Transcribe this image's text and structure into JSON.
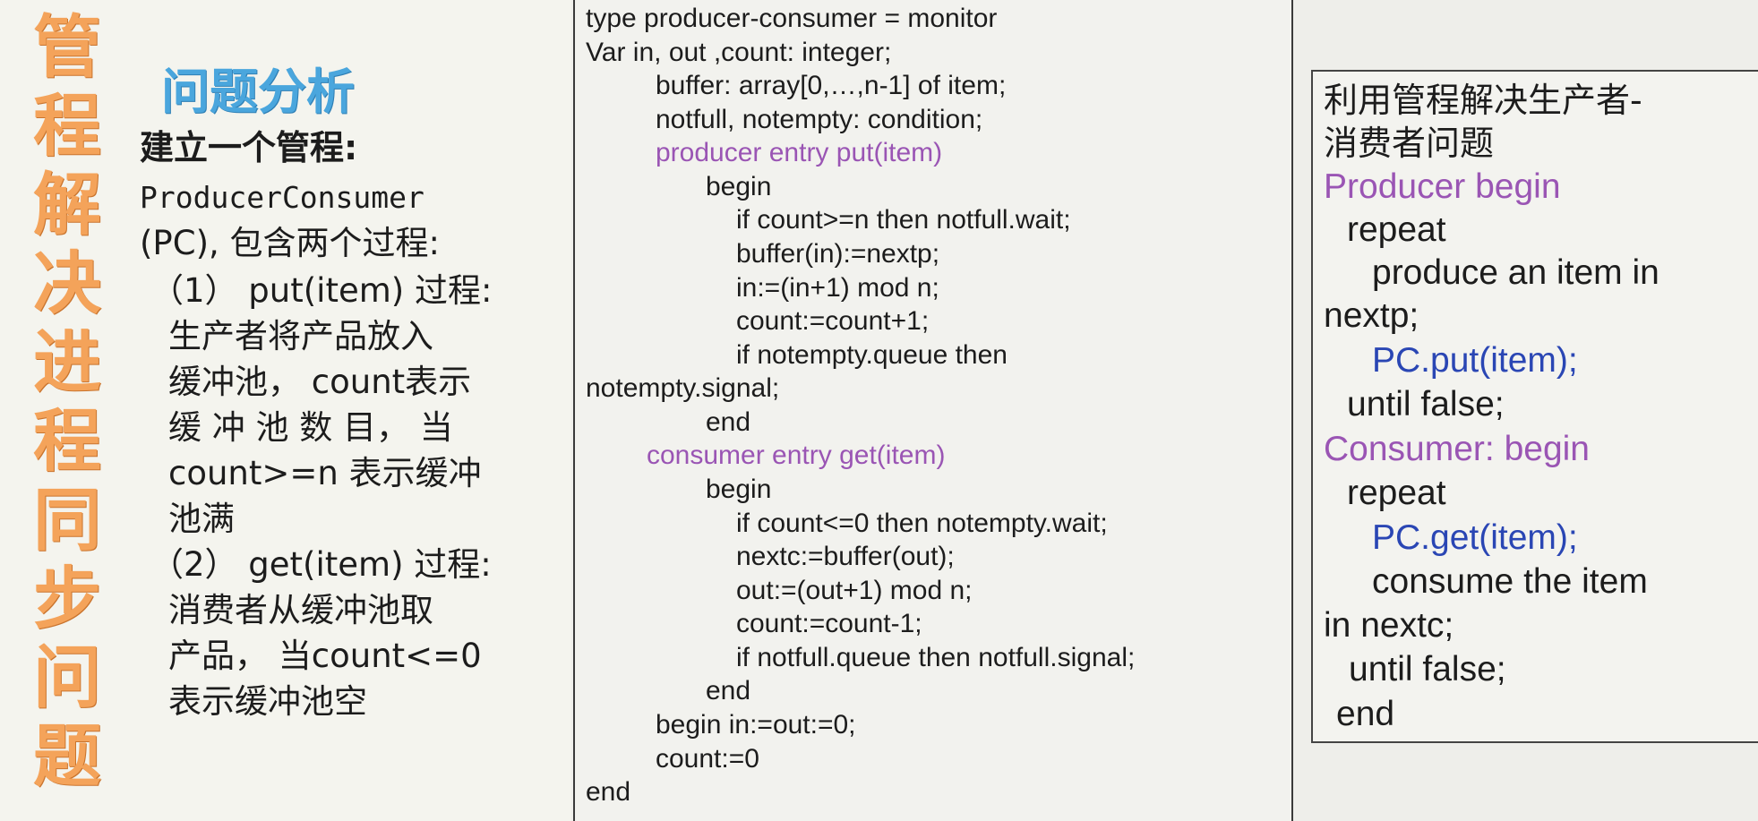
{
  "vertical_title": [
    "管",
    "程",
    "解",
    "决",
    "进",
    "程",
    "同",
    "步",
    "问",
    "题"
  ],
  "left": {
    "heading": "问题分析",
    "subheading": "建立一个管程:",
    "lines": [
      "ProducerConsumer",
      "(PC), 包含两个过程:",
      "（1） put(item) 过程:",
      "生产者将产品放入",
      "缓冲池， count表示",
      "缓 冲 池 数 目， 当",
      "count>=n 表示缓冲",
      "池满",
      "（2） get(item) 过程:",
      "消费者从缓冲池取",
      "产品， 当count<=0",
      "表示缓冲池空"
    ]
  },
  "code": {
    "lines": [
      "type producer-consumer = monitor",
      "Var in, out ,count: integer;",
      "buffer: array[0,…,n-1] of item;",
      "notfull, notempty: condition;",
      "producer entry put(item)",
      "begin",
      "if count>=n then notfull.wait;",
      "buffer(in):=nextp;",
      "in:=(in+1) mod n;",
      "count:=count+1;",
      "if notempty.queue then",
      "notempty.signal;",
      "end",
      "consumer entry get(item)",
      "begin",
      "if count<=0 then notempty.wait;",
      "nextc:=buffer(out);",
      "out:=(out+1) mod n;",
      "count:=count-1;",
      "if notfull.queue then notfull.signal;",
      "end",
      "begin in:=out:=0;",
      "count:=0",
      "end"
    ]
  },
  "right": {
    "lines": [
      "利用管程解决生产者-",
      "消费者问题",
      "Producer begin",
      "repeat",
      "produce an item in",
      "nextp;",
      "PC.put(item);",
      "until false;",
      "Consumer: begin",
      "repeat",
      "PC.get(item);",
      "consume the item",
      "in nextc;",
      "until false;",
      "end"
    ]
  },
  "colors": {
    "title_orange": "#f4a35a",
    "heading_blue": "#4aa6dd",
    "keyword_purple": "#9a55b4",
    "call_blue": "#2a46b4"
  }
}
